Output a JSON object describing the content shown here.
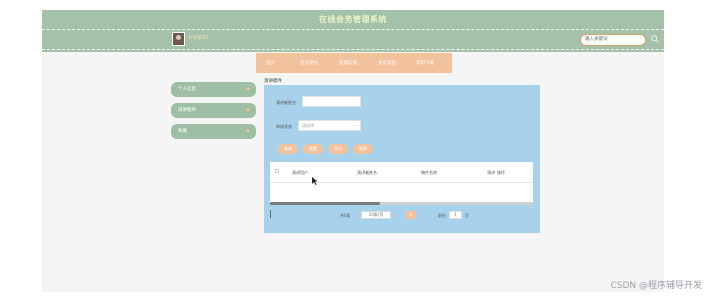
{
  "header": {
    "title": "在线会务管理系统",
    "username": "演讲嘉宾1",
    "search_placeholder": "输入关键词"
  },
  "nav": {
    "items": [
      "首页",
      "会议地点",
      "签到信息",
      "会议日程",
      "资料下载"
    ]
  },
  "sidebar": {
    "items": [
      {
        "label": "个人信息"
      },
      {
        "label": "演讲稿件"
      },
      {
        "label": "收藏"
      }
    ]
  },
  "main": {
    "breadcrumb": "演讲稿件",
    "form": {
      "name_label": "演讲者姓名",
      "status_label": "审核状态",
      "status_placeholder": "请选择"
    },
    "buttons": [
      "查询",
      "重置",
      "导出",
      "删除"
    ],
    "table": {
      "columns": [
        "演讲用户",
        "演讲者姓名",
        "稿件名称",
        "演讲",
        "操作"
      ]
    },
    "pagination": {
      "total_text": "共0条",
      "page_size": "10条/页",
      "current_page": "1",
      "goto_label": "前往",
      "goto_value": "1",
      "page_unit": "页"
    }
  },
  "watermark": "CSDN @程序辅导开发"
}
